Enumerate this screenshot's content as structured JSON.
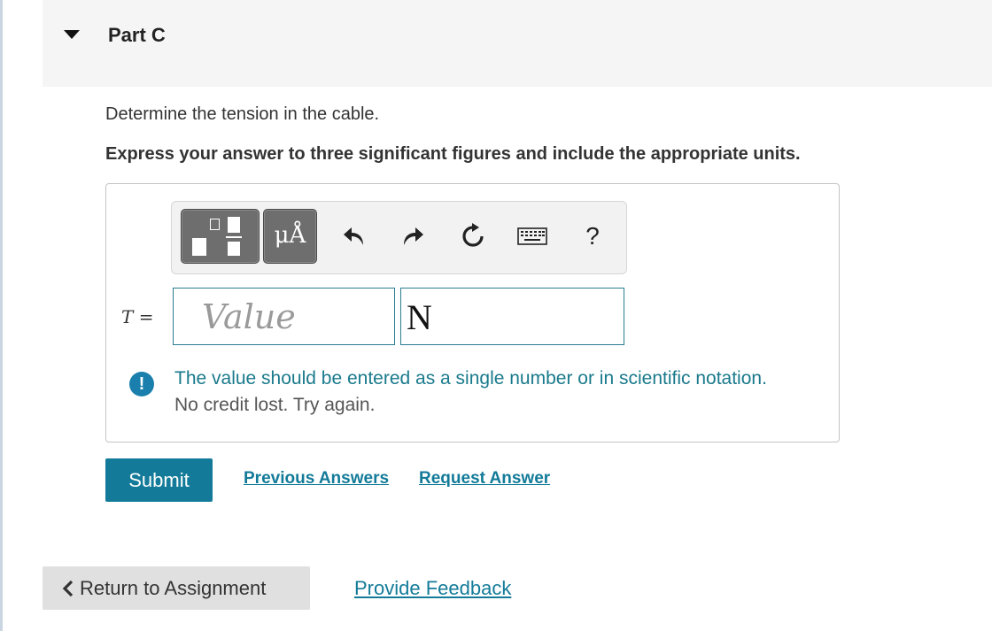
{
  "part": {
    "title": "Part C"
  },
  "question": {
    "text": "Determine the tension in the cable.",
    "instruction": "Express your answer to three significant figures and include the appropriate units."
  },
  "toolbar": {
    "units_label": "μÅ",
    "help_label": "?",
    "icons": [
      "templates-icon",
      "units-icon",
      "undo-icon",
      "redo-icon",
      "reset-icon",
      "keyboard-icon",
      "help-icon"
    ]
  },
  "answer": {
    "variable": "T",
    "equals": "=",
    "value_placeholder": "Value",
    "value": "",
    "unit": "N"
  },
  "feedback": {
    "message": "The value should be entered as a single number or in scientific notation.",
    "note": "No credit lost. Try again."
  },
  "actions": {
    "submit_label": "Submit",
    "previous_answers_label": "Previous Answers",
    "request_answer_label": "Request Answer"
  },
  "footer": {
    "return_label": "Return to Assignment",
    "feedback_label": "Provide Feedback"
  },
  "colors": {
    "accent": "#137b99",
    "feedback_text": "#1a7a8c",
    "alert_icon": "#1a7fad",
    "header_bg": "#f5f5f5"
  }
}
